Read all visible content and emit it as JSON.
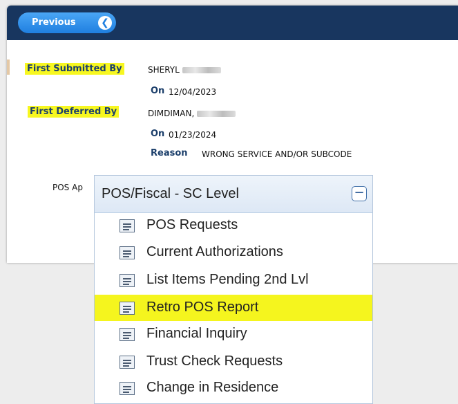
{
  "toolbar": {
    "previous_label": "Previous",
    "previous_icon": "chevron-left-icon"
  },
  "details": {
    "first_submitted_by_label": "First Submitted By",
    "first_submitted_by_value": "SHERYL",
    "submitted_on_label": "On",
    "submitted_on_value": "12/04/2023",
    "first_deferred_by_label": "First Deferred By",
    "first_deferred_by_value": "DIMDIMAN,",
    "deferred_on_label": "On",
    "deferred_on_value": "01/23/2024",
    "reason_label": "Reason",
    "reason_value": "WRONG SERVICE AND/OR SUBCODE",
    "pos_label": "POS Ap"
  },
  "menu": {
    "title": "POS/Fiscal - SC Level",
    "collapse_symbol": "−",
    "items": [
      {
        "label": "POS Requests"
      },
      {
        "label": "Current Authorizations"
      },
      {
        "label": "List Items Pending 2nd Lvl"
      },
      {
        "label": "Retro POS Report"
      },
      {
        "label": "Financial Inquiry"
      },
      {
        "label": "Trust Check Requests"
      },
      {
        "label": "Change in Residence"
      }
    ],
    "highlight_index": 3
  },
  "colors": {
    "header": "#18365f",
    "highlight": "#f7f720",
    "button": "#1f7fe0",
    "label": "#1c3f6b"
  }
}
